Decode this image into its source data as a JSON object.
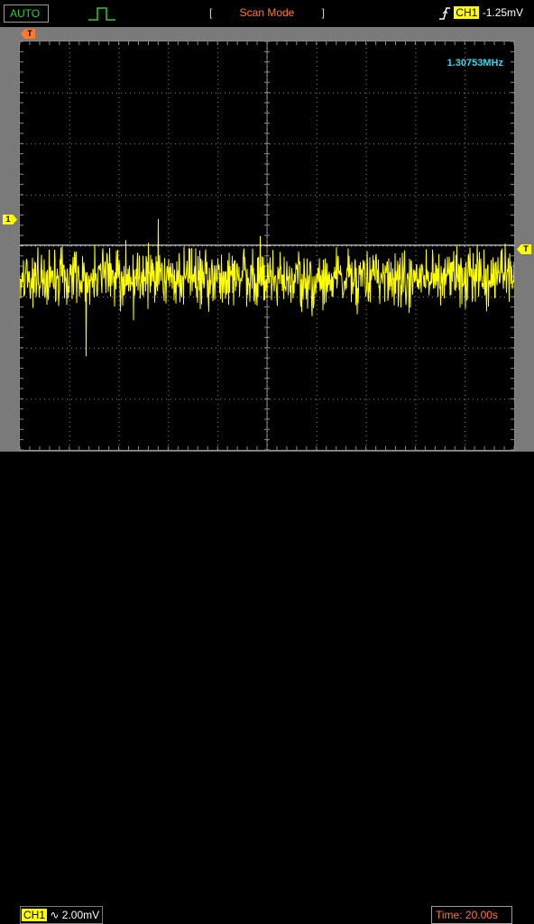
{
  "status": {
    "run_mode": "AUTO",
    "acquisition_mode": "Scan Mode",
    "trigger_icon": "pulse-icon"
  },
  "trigger": {
    "channel": "CH1",
    "level": "-1.25mV",
    "edge_icon": "rising-edge-icon"
  },
  "measurement": {
    "frequency": "1.30753MHz"
  },
  "channel": {
    "name": "CH1",
    "coupling_icon": "ac-coupling-icon",
    "coupling_symbol": "∿",
    "scale": "2.00mV"
  },
  "timebase": {
    "label": "Time:",
    "value": "20.00s"
  },
  "markers": {
    "trigger_position": "T",
    "channel_offset": "1",
    "trigger_level": "T"
  },
  "colors": {
    "trace": "#ffff00",
    "grid": "#8a8a8a",
    "frequency": "#34d6f0",
    "status_orange": "#ff7a2e",
    "auto_green": "#2ecc40"
  }
}
